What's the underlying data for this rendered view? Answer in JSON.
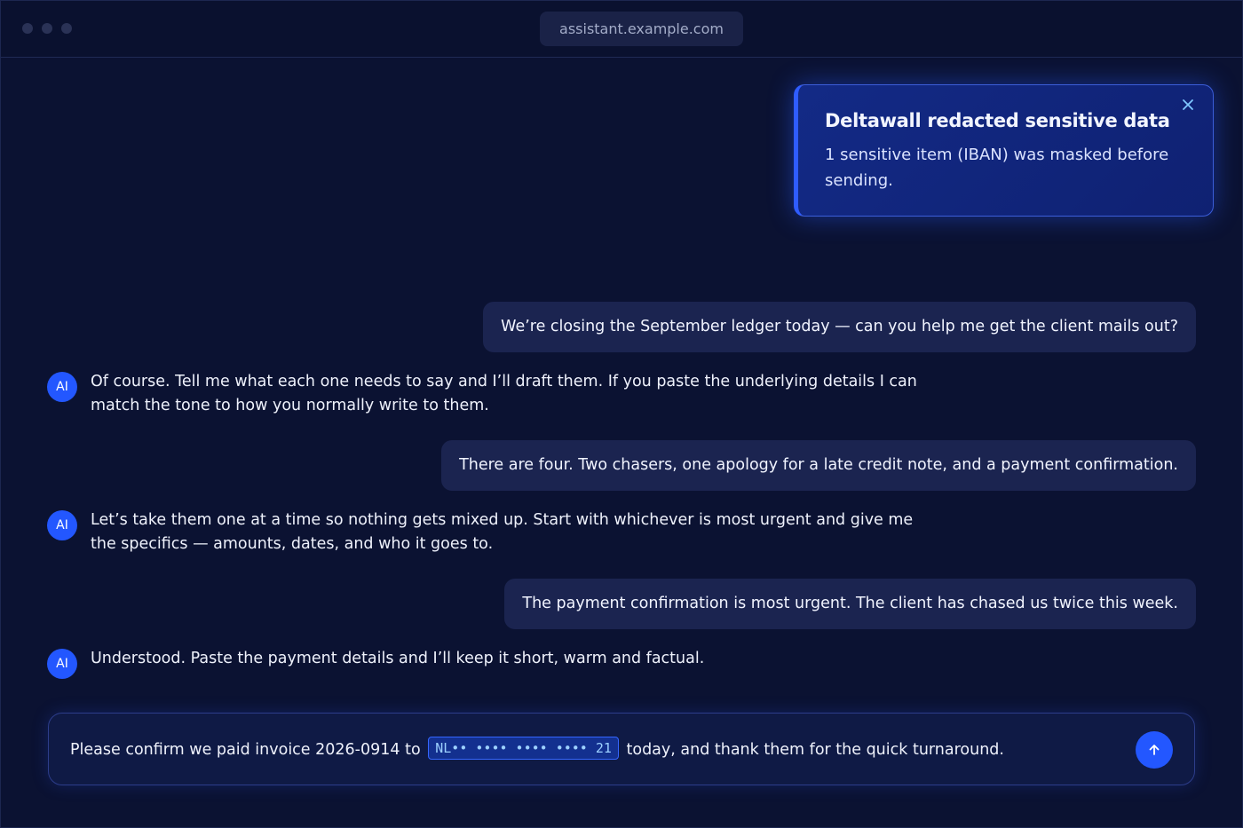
{
  "browser": {
    "url": "assistant.example.com"
  },
  "toast": {
    "title": "Deltawall redacted sensitive data",
    "body": "1 sensitive item (IBAN) was masked before sending.",
    "close_icon": "close-icon"
  },
  "messages": [
    {
      "role": "user",
      "text": "We’re closing the September ledger today — can you help me get the client mails out?"
    },
    {
      "role": "assistant",
      "avatar": "AI",
      "text": "Of course. Tell me what each one needs to say and I’ll draft them. If you paste the underlying details I can match the tone to how you normally write to them."
    },
    {
      "role": "user",
      "text": "There are four. Two chasers, one apology for a late credit note, and a payment confirmation."
    },
    {
      "role": "assistant",
      "avatar": "AI",
      "text": "Let’s take them one at a time so nothing gets mixed up. Start with whichever is most urgent and give me the specifics — amounts, dates, and who it goes to."
    },
    {
      "role": "user",
      "text": "The payment confirmation is most urgent. The client has chased us twice this week."
    },
    {
      "role": "assistant",
      "avatar": "AI",
      "text": "Understood. Paste the payment details and I’ll keep it short, warm and factual."
    }
  ],
  "composer": {
    "text_before": "Please confirm we paid invoice 2026-0914 to",
    "redacted_value": "NL•• •••• •••• •••• 21",
    "text_after": "today, and thank them for the quick turnaround.",
    "send_icon": "arrow-up-icon"
  },
  "colors": {
    "background": "#0b1232",
    "accent": "#2357ff",
    "user_bubble": "#1b2450",
    "toast": "#132a86"
  }
}
